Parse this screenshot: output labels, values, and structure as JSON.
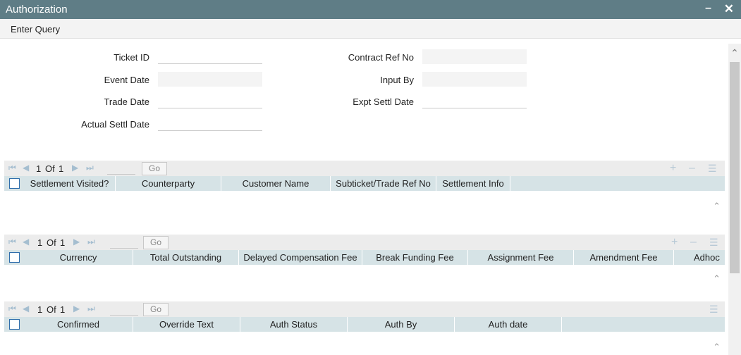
{
  "window": {
    "title": "Authorization",
    "minimize_label": "–",
    "close_label": "✕"
  },
  "menu": {
    "enter_query": "Enter Query"
  },
  "form": {
    "ticket_id": {
      "label": "Ticket ID",
      "value": ""
    },
    "contract_ref_no": {
      "label": "Contract Ref No",
      "value": ""
    },
    "event_date": {
      "label": "Event Date",
      "value": ""
    },
    "input_by": {
      "label": "Input By",
      "value": ""
    },
    "trade_date": {
      "label": "Trade Date",
      "value": ""
    },
    "expt_settl_date": {
      "label": "Expt Settl Date",
      "value": ""
    },
    "actual_settl_date": {
      "label": "Actual Settl Date",
      "value": ""
    }
  },
  "icons": {
    "first": "⏮",
    "prev": "◀",
    "next": "▶",
    "last": "⏭",
    "add": "+",
    "remove": "–",
    "options": "☰",
    "scroll_up": "⌃"
  },
  "grids": [
    {
      "page_current": "1",
      "page_of": "Of",
      "page_total": "1",
      "go_label": "Go",
      "columns": [
        "Settlement Visited?",
        "Counterparty",
        "Customer Name",
        "Subticket/Trade Ref No",
        "Settlement Info"
      ]
    },
    {
      "page_current": "1",
      "page_of": "Of",
      "page_total": "1",
      "go_label": "Go",
      "columns": [
        "Currency",
        "Total Outstanding",
        "Delayed Compensation Fee",
        "Break Funding Fee",
        "Assignment Fee",
        "Amendment Fee",
        "Adhoc"
      ]
    },
    {
      "page_current": "1",
      "page_of": "Of",
      "page_total": "1",
      "go_label": "Go",
      "columns": [
        "Confirmed",
        "Override Text",
        "Auth Status",
        "Auth By",
        "Auth date"
      ]
    }
  ],
  "colors": {
    "titlebar": "#5f7d86",
    "header": "#d6e3e6",
    "pager": "#ececec",
    "checkbox_border": "#2f6eab"
  }
}
